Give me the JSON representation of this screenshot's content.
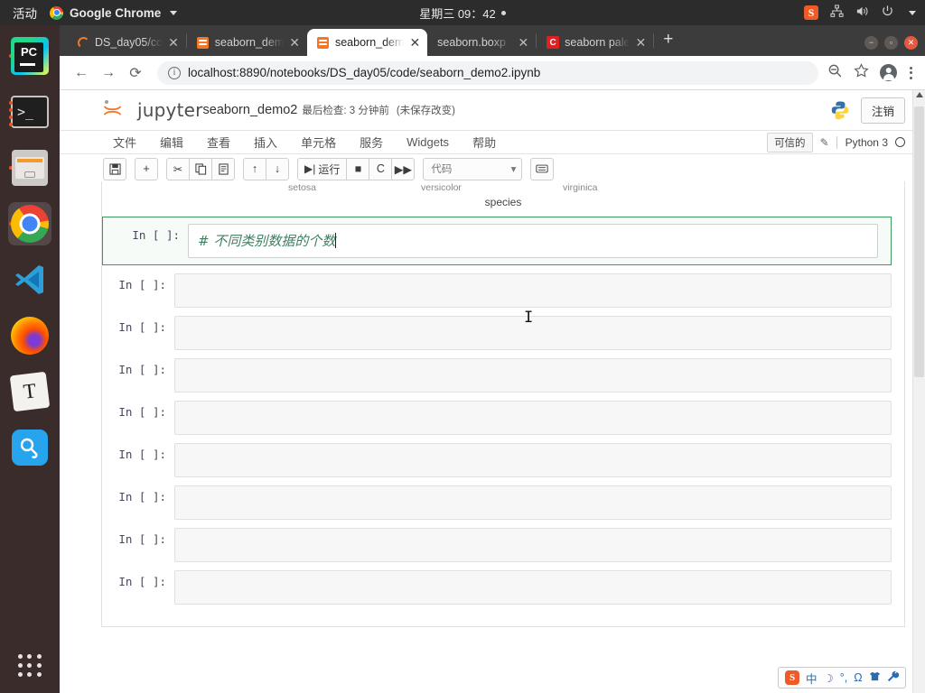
{
  "desktop": {
    "activities_label": "活动",
    "active_app": "Google Chrome",
    "clock": "星期三 09：42",
    "tray_icons": [
      "sogou-icon",
      "network-icon",
      "volume-icon",
      "power-icon",
      "chevron-down-icon"
    ],
    "dock_items": [
      {
        "name": "pycharm",
        "label": "PC",
        "running": true,
        "active": false
      },
      {
        "name": "terminal",
        "label": ">_",
        "running": true,
        "active": false
      },
      {
        "name": "files",
        "label": "",
        "running": true,
        "active": false
      },
      {
        "name": "google-chrome",
        "label": "",
        "running": true,
        "active": true
      },
      {
        "name": "vscode",
        "label": "",
        "running": false,
        "active": false
      },
      {
        "name": "firefox",
        "label": "",
        "running": false,
        "active": false
      },
      {
        "name": "typora",
        "label": "T",
        "running": false,
        "active": false
      },
      {
        "name": "search-tool",
        "label": "",
        "running": false,
        "active": false
      }
    ]
  },
  "browser": {
    "tabs": [
      {
        "title": "DS_day05/co",
        "favicon": "loading-ring-icon",
        "active": false
      },
      {
        "title": "seaborn_dem",
        "favicon": "jupyter-icon",
        "active": false
      },
      {
        "title": "seaborn_dem",
        "favicon": "jupyter-icon",
        "active": true
      },
      {
        "title": "seaborn.boxp",
        "favicon": "none",
        "active": false
      },
      {
        "title": "seaborn pale",
        "favicon": "csdn-icon",
        "active": false
      }
    ],
    "new_tab_label": "+",
    "window_buttons": [
      "minimize",
      "maximize",
      "close"
    ],
    "back_label": "←",
    "forward_label": "→",
    "reload_label": "⟳",
    "url": "localhost:8890/notebooks/DS_day05/code/seaborn_demo2.ipynb",
    "omni_actions": [
      "zoom-out-icon",
      "bookmark-star-icon",
      "profile-avatar-icon",
      "chrome-menu-icon"
    ]
  },
  "jupyter": {
    "logo_text": "jupyter",
    "notebook_name": "seaborn_demo2",
    "checkpoint_text": "最后检查: 3 分钟前",
    "modified_text": "(未保存改变)",
    "logout_label": "注销",
    "menus": [
      "文件",
      "编辑",
      "查看",
      "插入",
      "单元格",
      "服务",
      "Widgets",
      "帮助"
    ],
    "trusted_label": "可信的",
    "kernel_label": "Python 3",
    "toolbar": {
      "save_label": "💾",
      "insert_label": "+",
      "cut_label": "✂",
      "copy_label": "❐",
      "paste_label": "❏",
      "move_up_label": "↑",
      "move_down_label": "↓",
      "run_label": "运行",
      "stop_label": "■",
      "restart_label": "C",
      "restart_run_all_label": "⏩",
      "cell_type_value": "代码",
      "command_palette_label": "⌨"
    },
    "chart_remnant": {
      "tick_labels": [
        "setosa",
        "versicolor",
        "virginica"
      ],
      "axis_label": "species"
    },
    "cells": [
      {
        "prompt": "In [ ]:",
        "source": "# 不同类别数据的个数",
        "selected": true
      },
      {
        "prompt": "In [ ]:",
        "source": "",
        "selected": false
      },
      {
        "prompt": "In [ ]:",
        "source": "",
        "selected": false
      },
      {
        "prompt": "In [ ]:",
        "source": "",
        "selected": false
      },
      {
        "prompt": "In [ ]:",
        "source": "",
        "selected": false
      },
      {
        "prompt": "In [ ]:",
        "source": "",
        "selected": false
      },
      {
        "prompt": "In [ ]:",
        "source": "",
        "selected": false
      },
      {
        "prompt": "In [ ]:",
        "source": "",
        "selected": false
      },
      {
        "prompt": "In [ ]:",
        "source": "",
        "selected": false
      }
    ]
  },
  "ime": {
    "logo": "S",
    "mode_label": "中",
    "items": [
      "中",
      "☽",
      "°,",
      "Ω",
      "👕",
      "🔧"
    ]
  }
}
